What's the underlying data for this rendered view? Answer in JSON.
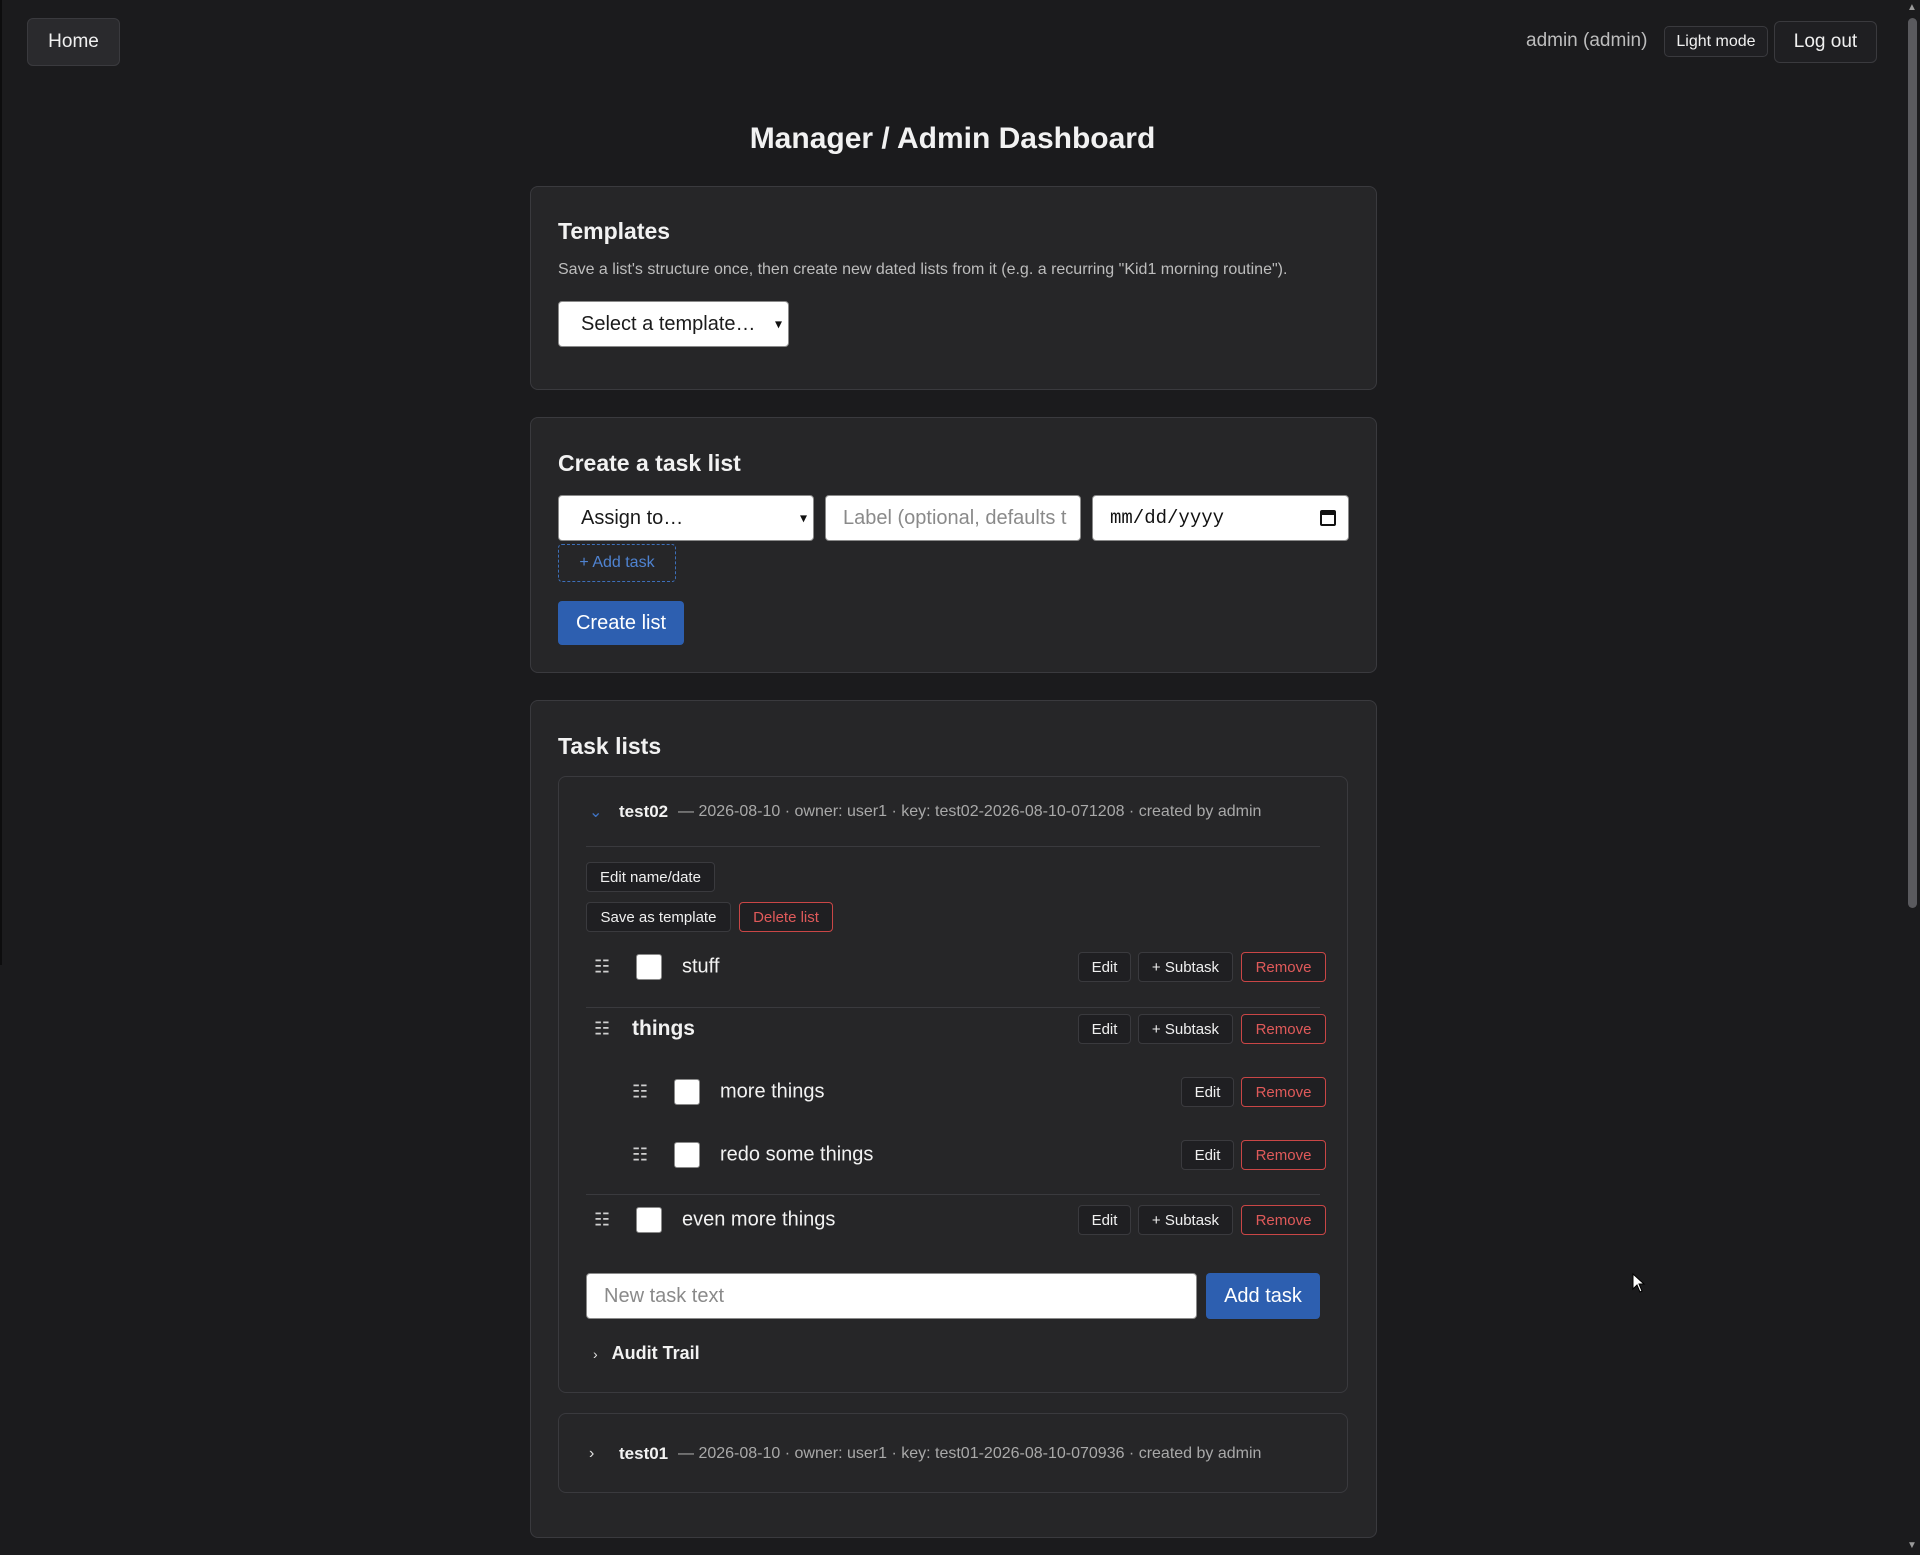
{
  "nav": {
    "home_label": "Home",
    "user_label": "admin (admin)",
    "light_mode_label": "Light mode",
    "logout_label": "Log out"
  },
  "page": {
    "title": "Manager / Admin Dashboard"
  },
  "templates": {
    "heading": "Templates",
    "description": "Save a list's structure once, then create new dated lists from it (e.g. a recurring \"Kid1 morning routine\").",
    "select_value": "Select a template…"
  },
  "create": {
    "heading": "Create a task list",
    "assign_value": "Assign to…",
    "label_placeholder": "Label (optional, defaults t",
    "date_placeholder": "mm/dd/yyyy",
    "add_task_label": "+ Add task",
    "create_button": "Create list"
  },
  "task_lists": {
    "heading": "Task lists",
    "lists": [
      {
        "name": "test02",
        "meta": "— 2026-08-10 · owner: user1 · key: test02-2026-08-10-071208 · created by admin",
        "actions": {
          "edit": "Edit name/date",
          "save_template": "Save as template",
          "delete": "Delete list"
        },
        "tasks": [
          {
            "text": "stuff",
            "edit": "Edit",
            "subtask": "+ Subtask",
            "remove": "Remove"
          },
          {
            "text": "things",
            "edit": "Edit",
            "subtask": "+ Subtask",
            "remove": "Remove",
            "subtasks": [
              {
                "text": "more things",
                "edit": "Edit",
                "remove": "Remove"
              },
              {
                "text": "redo some things",
                "edit": "Edit",
                "remove": "Remove"
              }
            ]
          },
          {
            "text": "even more things",
            "edit": "Edit",
            "subtask": "+ Subtask",
            "remove": "Remove"
          }
        ],
        "new_task_placeholder": "New task text",
        "add_task_button": "Add task",
        "audit_label": "Audit Trail"
      },
      {
        "name": "test01",
        "meta": "— 2026-08-10 · owner: user1 · key: test01-2026-08-10-070936 · created by admin"
      }
    ]
  },
  "icons": {
    "caret_open": "chevron-down-icon",
    "caret_closed": "chevron-right-icon",
    "grip": "drag-handle-icon",
    "calendar": "calendar-icon"
  },
  "colors": {
    "accent": "#2d5fb0",
    "danger": "#e05a5a",
    "background": "#1b1b1d",
    "card": "#262628"
  }
}
